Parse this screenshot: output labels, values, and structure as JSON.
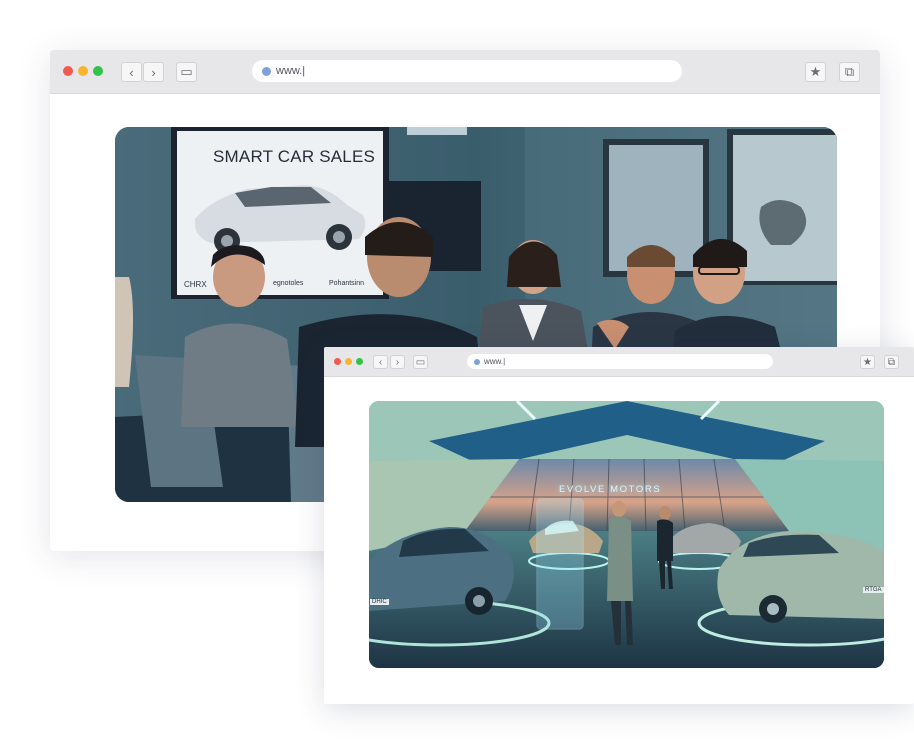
{
  "window_back": {
    "url": "www.|",
    "nav": {
      "back_icon": "‹",
      "forward_icon": "›"
    },
    "tools": {
      "sidebar_icon": "▭",
      "bookmark_icon": "★",
      "tabs_icon": "⧉"
    }
  },
  "window_front": {
    "url": "www.|",
    "nav": {
      "back_icon": "‹",
      "forward_icon": "›"
    },
    "tools": {
      "sidebar_icon": "▭",
      "bookmark_icon": "★",
      "tabs_icon": "⧉"
    }
  },
  "meeting_photo": {
    "screen_title": "SMART CAR SALES",
    "screen_footer": [
      "CHRX",
      "egnotoles",
      "Pohantsinn"
    ]
  },
  "showroom_photo": {
    "sign": "EVOLVE MOTORS",
    "plates": [
      "DHIC",
      "RTGA"
    ]
  },
  "colors": {
    "dot_red": "#f25a4f",
    "dot_yellow": "#f7b42c",
    "dot_green": "#33c24a",
    "accent_blue": "#6f8cf6",
    "accent_green": "#79e3b3",
    "chrome_bg": "#e7e7e9"
  }
}
